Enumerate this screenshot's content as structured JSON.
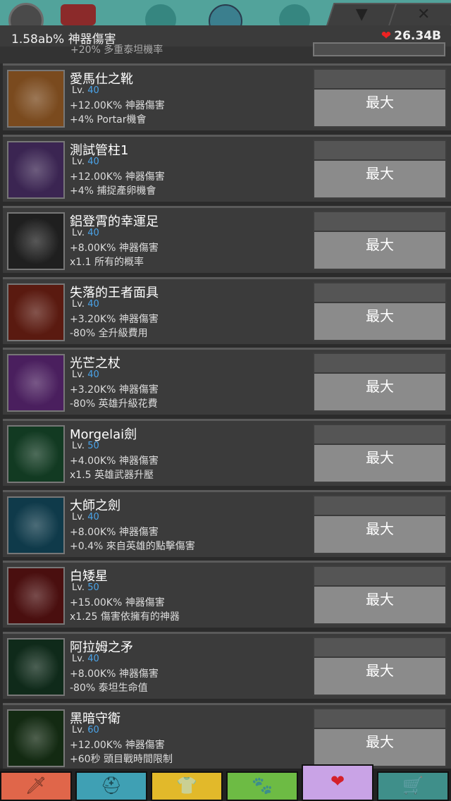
{
  "topbar": {
    "chevron_glyph": "▼",
    "close_glyph": "✕"
  },
  "status": {
    "damage": "1.58ab% 神器傷害",
    "gold": "26.34B",
    "gold_icon": "heart-gift-icon"
  },
  "partial_row": {
    "effect": "+20% 多重泰坦機率"
  },
  "artifacts": [
    {
      "name": "愛馬仕之靴",
      "lv_prefix": "Lv.",
      "lv": "40",
      "effect1": "+12.00K% 神器傷害",
      "effect2": "+4% Portar機會",
      "button": "最大",
      "icon": "winged-boots-icon",
      "bg": "#7a4a1e"
    },
    {
      "name": "測試管柱1",
      "lv_prefix": "Lv.",
      "lv": "40",
      "effect1": "+12.00K% 神器傷害",
      "effect2": "+4% 捕捉產卵機會",
      "button": "最大",
      "icon": "gauntlet-icon",
      "bg": "#3b2552"
    },
    {
      "name": "鋁登霄的幸運足",
      "lv_prefix": "Lv.",
      "lv": "40",
      "effect1": "+8.00K% 神器傷害",
      "effect2": "x1.1 所有的概率",
      "button": "最大",
      "icon": "lucky-foot-icon",
      "bg": "#1f1f1f"
    },
    {
      "name": "失落的王者面具",
      "lv_prefix": "Lv.",
      "lv": "40",
      "effect1": "+3.20K% 神器傷害",
      "effect2": "-80% 全升級費用",
      "button": "最大",
      "icon": "golden-mask-icon",
      "bg": "#5a1a10"
    },
    {
      "name": "光芒之杖",
      "lv_prefix": "Lv.",
      "lv": "40",
      "effect1": "+3.20K% 神器傷害",
      "effect2": "-80% 英雄升級花費",
      "button": "最大",
      "icon": "radiant-staff-icon",
      "bg": "#4a1f5e"
    },
    {
      "name": "Morgelai劍",
      "lv_prefix": "Lv.",
      "lv": "50",
      "effect1": "+4.00K% 神器傷害",
      "effect2": "x1.5 英雄武器升壓",
      "button": "最大",
      "icon": "green-sword-icon",
      "bg": "#123a22"
    },
    {
      "name": "大師之劍",
      "lv_prefix": "Lv.",
      "lv": "40",
      "effect1": "+8.00K% 神器傷害",
      "effect2": "+0.4% 來自英雄的點擊傷害",
      "button": "最大",
      "icon": "master-sword-icon",
      "bg": "#0f3a4a"
    },
    {
      "name": "白矮星",
      "lv_prefix": "Lv.",
      "lv": "50",
      "effect1": "+15.00K% 神器傷害",
      "effect2": "x1.25 傷害依擁有的神器",
      "button": "最大",
      "icon": "white-hammer-icon",
      "bg": "#4a0f0f"
    },
    {
      "name": "阿拉姆之矛",
      "lv_prefix": "Lv.",
      "lv": "40",
      "effect1": "+8.00K% 神器傷害",
      "effect2": "-80% 泰坦生命值",
      "button": "最大",
      "icon": "spear-icon",
      "bg": "#0f2a1a"
    },
    {
      "name": "黑暗守衛",
      "lv_prefix": "Lv.",
      "lv": "60",
      "effect1": "+12.00K% 神器傷害",
      "effect2": "+60秒 頭目戰時間限制",
      "button": "最大",
      "icon": "dark-guard-icon",
      "bg": "#132a12"
    }
  ],
  "bottom_nav": [
    {
      "icon": "sword-icon",
      "color": "#e0664a"
    },
    {
      "icon": "viking-helmet-icon",
      "color": "#3fa0b4"
    },
    {
      "icon": "shirt-icon",
      "color": "#e2b92a"
    },
    {
      "icon": "pet-icon",
      "color": "#6dbb44"
    },
    {
      "icon": "artifact-heart-icon",
      "color": "#c9a3e6"
    },
    {
      "icon": "shop-icon",
      "color": "#3f8f8a"
    }
  ]
}
